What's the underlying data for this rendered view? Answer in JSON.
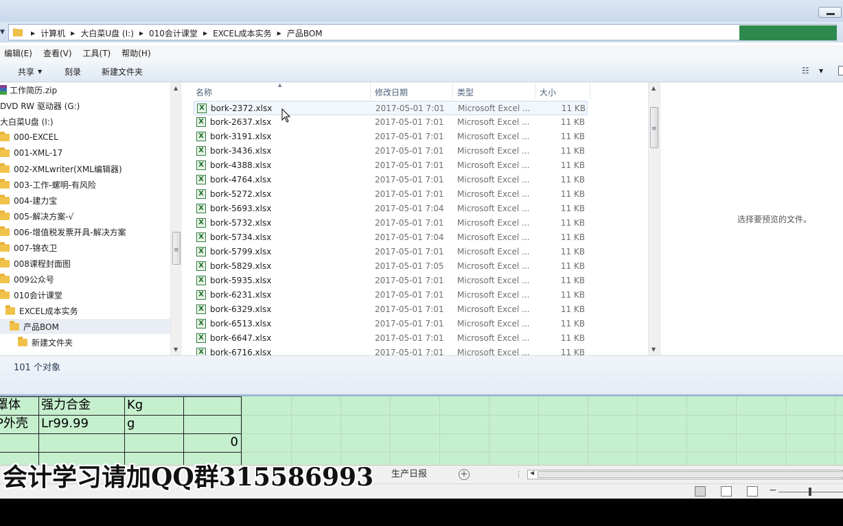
{
  "explorer": {
    "breadcrumb": [
      "计算机",
      "大白菜U盘 (I:)",
      "010会计课堂",
      "EXCEL成本实务",
      "产品BOM"
    ],
    "menu": [
      "编辑(E)",
      "查看(V)",
      "工具(T)",
      "帮助(H)"
    ],
    "toolbar": {
      "share": "共享",
      "burn": "刻录",
      "new_folder": "新建文件夹"
    },
    "nav_items": [
      {
        "label": "工作简历.zip",
        "icon": "zip-icon"
      },
      {
        "label": "DVD RW 驱动器 (G:)",
        "icon": "dvd-drive-icon"
      },
      {
        "label": "大白菜U盘 (I:)",
        "icon": "usb-drive-icon"
      },
      {
        "label": "000-EXCEL",
        "icon": "folder-icon"
      },
      {
        "label": "001-XML-17",
        "icon": "folder-icon"
      },
      {
        "label": "002-XMLwriter(XML编辑器)",
        "icon": "folder-icon"
      },
      {
        "label": "003-工作-螺明-有风险",
        "icon": "folder-icon"
      },
      {
        "label": "004-建力宝",
        "icon": "folder-icon"
      },
      {
        "label": "005-解决方案-√",
        "icon": "folder-icon"
      },
      {
        "label": "006-增值税发票开具-解决方案",
        "icon": "folder-icon"
      },
      {
        "label": "007-锦衣卫",
        "icon": "folder-icon"
      },
      {
        "label": "008课程封面图",
        "icon": "folder-icon"
      },
      {
        "label": "009公众号",
        "icon": "folder-icon"
      },
      {
        "label": "010会计课堂",
        "icon": "folder-icon"
      },
      {
        "label": "EXCEL成本实务",
        "icon": "folder-icon"
      },
      {
        "label": "产品BOM",
        "icon": "folder-icon",
        "selected": true
      },
      {
        "label": "新建文件夹",
        "icon": "folder-icon"
      }
    ],
    "columns": {
      "name": "名称",
      "date": "修改日期",
      "type": "类型",
      "size": "大小"
    },
    "files": [
      {
        "name": "bork-2372.xlsx",
        "date": "2017-05-01 7:01",
        "type": "Microsoft Excel ...",
        "size": "11 KB"
      },
      {
        "name": "bork-2637.xlsx",
        "date": "2017-05-01 7:01",
        "type": "Microsoft Excel ...",
        "size": "11 KB"
      },
      {
        "name": "bork-3191.xlsx",
        "date": "2017-05-01 7:01",
        "type": "Microsoft Excel ...",
        "size": "11 KB"
      },
      {
        "name": "bork-3436.xlsx",
        "date": "2017-05-01 7:01",
        "type": "Microsoft Excel ...",
        "size": "11 KB"
      },
      {
        "name": "bork-4388.xlsx",
        "date": "2017-05-01 7:01",
        "type": "Microsoft Excel ...",
        "size": "11 KB"
      },
      {
        "name": "bork-4764.xlsx",
        "date": "2017-05-01 7:01",
        "type": "Microsoft Excel ...",
        "size": "11 KB"
      },
      {
        "name": "bork-5272.xlsx",
        "date": "2017-05-01 7:01",
        "type": "Microsoft Excel ...",
        "size": "11 KB"
      },
      {
        "name": "bork-5693.xlsx",
        "date": "2017-05-01 7:04",
        "type": "Microsoft Excel ...",
        "size": "11 KB"
      },
      {
        "name": "bork-5732.xlsx",
        "date": "2017-05-01 7:01",
        "type": "Microsoft Excel ...",
        "size": "11 KB"
      },
      {
        "name": "bork-5734.xlsx",
        "date": "2017-05-01 7:04",
        "type": "Microsoft Excel ...",
        "size": "11 KB"
      },
      {
        "name": "bork-5799.xlsx",
        "date": "2017-05-01 7:01",
        "type": "Microsoft Excel ...",
        "size": "11 KB"
      },
      {
        "name": "bork-5829.xlsx",
        "date": "2017-05-01 7:05",
        "type": "Microsoft Excel ...",
        "size": "11 KB"
      },
      {
        "name": "bork-5935.xlsx",
        "date": "2017-05-01 7:01",
        "type": "Microsoft Excel ...",
        "size": "11 KB"
      },
      {
        "name": "bork-6231.xlsx",
        "date": "2017-05-01 7:01",
        "type": "Microsoft Excel ...",
        "size": "11 KB"
      },
      {
        "name": "bork-6329.xlsx",
        "date": "2017-05-01 7:01",
        "type": "Microsoft Excel ...",
        "size": "11 KB"
      },
      {
        "name": "bork-6513.xlsx",
        "date": "2017-05-01 7:01",
        "type": "Microsoft Excel ...",
        "size": "11 KB"
      },
      {
        "name": "bork-6647.xlsx",
        "date": "2017-05-01 7:01",
        "type": "Microsoft Excel ...",
        "size": "11 KB"
      },
      {
        "name": "bork-6716.xlsx",
        "date": "2017-05-01 7:01",
        "type": "Microsoft Excel ...",
        "size": "11 KB"
      }
    ],
    "preview_text": "选择要预览的文件。",
    "status": "101 个对象"
  },
  "excel": {
    "rows": [
      [
        "罩体",
        "强力合金",
        "Kg",
        ""
      ],
      [
        "P外壳",
        "Lr99.99",
        "g",
        ""
      ],
      [
        "-",
        "",
        "",
        "0"
      ],
      [
        "",
        "",
        "",
        ""
      ]
    ],
    "sheet_tab": "生产日报",
    "add_sheet": "+",
    "dots": "⋮"
  },
  "watermark": "会计学习请加QQ群315586993",
  "colors": {
    "excel_green": "#c6efce",
    "addr_green": "#2d8a4e",
    "selection": "#e9eef4"
  }
}
